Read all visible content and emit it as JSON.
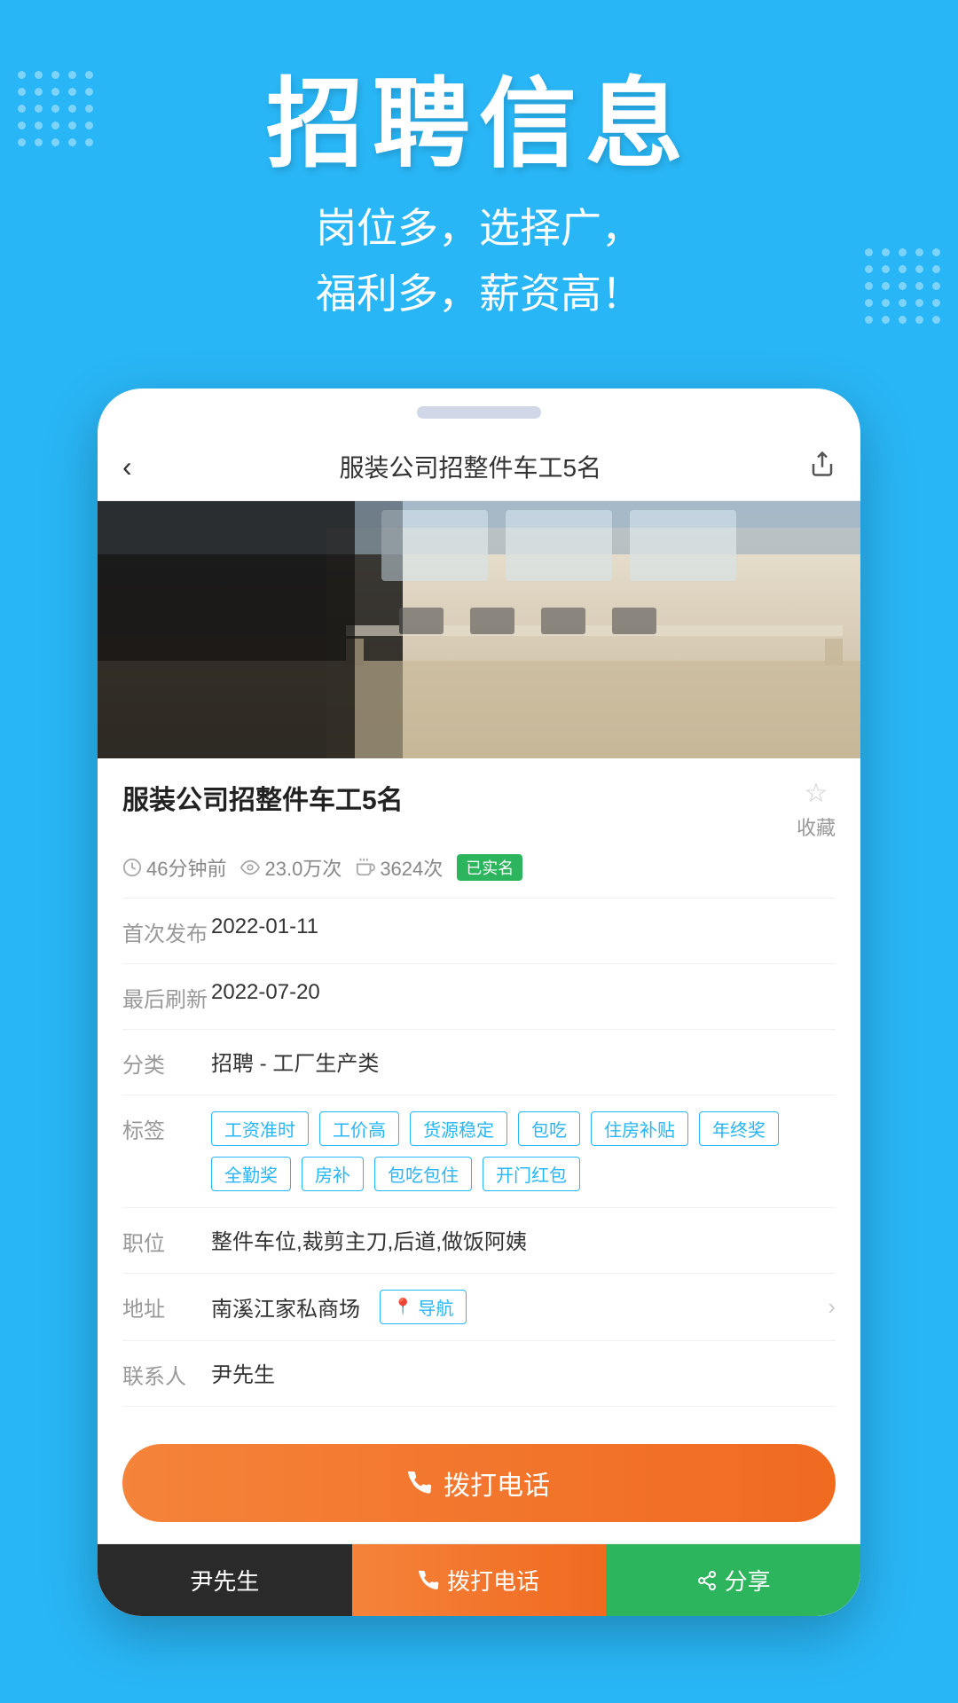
{
  "header": {
    "main_title": "招聘信息",
    "subtitle_line1": "岗位多，选择广，",
    "subtitle_line2": "福利多，薪资高！"
  },
  "nav": {
    "back_icon": "‹",
    "title": "服装公司招整件车工5名",
    "share_icon": "⇧"
  },
  "job": {
    "title": "服装公司招整件车工5名",
    "time_ago": "46分钟前",
    "views": "23.0万次",
    "applications": "3624次",
    "verified": "已实名",
    "bookmark_label": "收藏",
    "first_publish": "2022-01-11",
    "last_refresh": "2022-07-20",
    "category": "招聘 - 工厂生产类",
    "tags": [
      "工资准时",
      "工价高",
      "货源稳定",
      "包吃",
      "住房补贴",
      "年终奖",
      "全勤奖",
      "房补",
      "包吃包住",
      "开门红包"
    ],
    "positions": "整件车位,裁剪主刀,后道,做饭阿姨",
    "address": "南溪江家私商场",
    "nav_label": "导航",
    "contact": "尹先生",
    "call_label": "拨打电话",
    "labels": {
      "first_publish": "首次发布",
      "last_refresh": "最后刷新",
      "category": "分类",
      "tags": "标签",
      "positions": "职位",
      "address": "地址",
      "contact": "联系人"
    }
  },
  "bottom_bar": {
    "contact_name": "尹先生",
    "call_label": "拨打电话",
    "share_label": "分享"
  }
}
